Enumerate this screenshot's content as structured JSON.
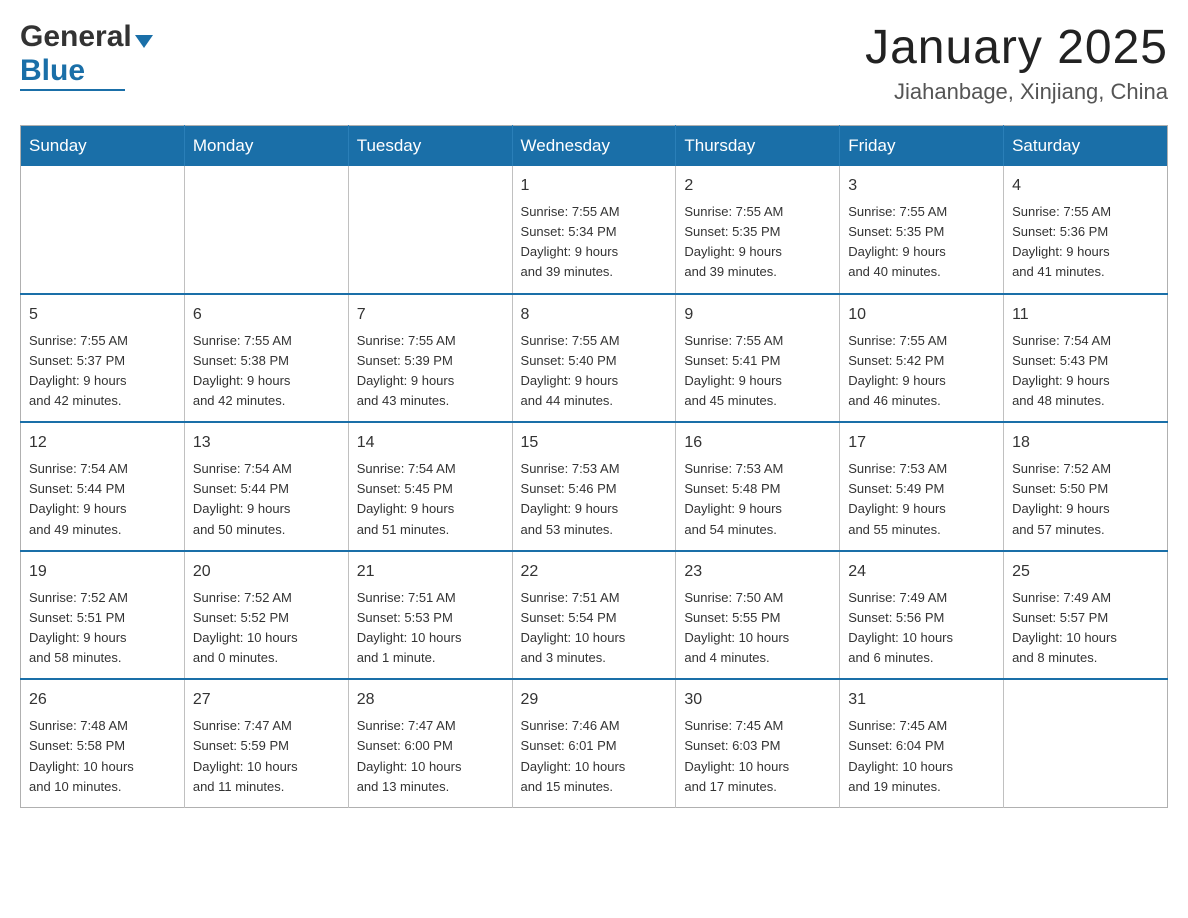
{
  "header": {
    "title": "January 2025",
    "subtitle": "Jiahanbage, Xinjiang, China"
  },
  "logo": {
    "general": "General",
    "blue": "Blue"
  },
  "days": [
    "Sunday",
    "Monday",
    "Tuesday",
    "Wednesday",
    "Thursday",
    "Friday",
    "Saturday"
  ],
  "weeks": [
    [
      {
        "day": "",
        "info": ""
      },
      {
        "day": "",
        "info": ""
      },
      {
        "day": "",
        "info": ""
      },
      {
        "day": "1",
        "info": "Sunrise: 7:55 AM\nSunset: 5:34 PM\nDaylight: 9 hours\nand 39 minutes."
      },
      {
        "day": "2",
        "info": "Sunrise: 7:55 AM\nSunset: 5:35 PM\nDaylight: 9 hours\nand 39 minutes."
      },
      {
        "day": "3",
        "info": "Sunrise: 7:55 AM\nSunset: 5:35 PM\nDaylight: 9 hours\nand 40 minutes."
      },
      {
        "day": "4",
        "info": "Sunrise: 7:55 AM\nSunset: 5:36 PM\nDaylight: 9 hours\nand 41 minutes."
      }
    ],
    [
      {
        "day": "5",
        "info": "Sunrise: 7:55 AM\nSunset: 5:37 PM\nDaylight: 9 hours\nand 42 minutes."
      },
      {
        "day": "6",
        "info": "Sunrise: 7:55 AM\nSunset: 5:38 PM\nDaylight: 9 hours\nand 42 minutes."
      },
      {
        "day": "7",
        "info": "Sunrise: 7:55 AM\nSunset: 5:39 PM\nDaylight: 9 hours\nand 43 minutes."
      },
      {
        "day": "8",
        "info": "Sunrise: 7:55 AM\nSunset: 5:40 PM\nDaylight: 9 hours\nand 44 minutes."
      },
      {
        "day": "9",
        "info": "Sunrise: 7:55 AM\nSunset: 5:41 PM\nDaylight: 9 hours\nand 45 minutes."
      },
      {
        "day": "10",
        "info": "Sunrise: 7:55 AM\nSunset: 5:42 PM\nDaylight: 9 hours\nand 46 minutes."
      },
      {
        "day": "11",
        "info": "Sunrise: 7:54 AM\nSunset: 5:43 PM\nDaylight: 9 hours\nand 48 minutes."
      }
    ],
    [
      {
        "day": "12",
        "info": "Sunrise: 7:54 AM\nSunset: 5:44 PM\nDaylight: 9 hours\nand 49 minutes."
      },
      {
        "day": "13",
        "info": "Sunrise: 7:54 AM\nSunset: 5:44 PM\nDaylight: 9 hours\nand 50 minutes."
      },
      {
        "day": "14",
        "info": "Sunrise: 7:54 AM\nSunset: 5:45 PM\nDaylight: 9 hours\nand 51 minutes."
      },
      {
        "day": "15",
        "info": "Sunrise: 7:53 AM\nSunset: 5:46 PM\nDaylight: 9 hours\nand 53 minutes."
      },
      {
        "day": "16",
        "info": "Sunrise: 7:53 AM\nSunset: 5:48 PM\nDaylight: 9 hours\nand 54 minutes."
      },
      {
        "day": "17",
        "info": "Sunrise: 7:53 AM\nSunset: 5:49 PM\nDaylight: 9 hours\nand 55 minutes."
      },
      {
        "day": "18",
        "info": "Sunrise: 7:52 AM\nSunset: 5:50 PM\nDaylight: 9 hours\nand 57 minutes."
      }
    ],
    [
      {
        "day": "19",
        "info": "Sunrise: 7:52 AM\nSunset: 5:51 PM\nDaylight: 9 hours\nand 58 minutes."
      },
      {
        "day": "20",
        "info": "Sunrise: 7:52 AM\nSunset: 5:52 PM\nDaylight: 10 hours\nand 0 minutes."
      },
      {
        "day": "21",
        "info": "Sunrise: 7:51 AM\nSunset: 5:53 PM\nDaylight: 10 hours\nand 1 minute."
      },
      {
        "day": "22",
        "info": "Sunrise: 7:51 AM\nSunset: 5:54 PM\nDaylight: 10 hours\nand 3 minutes."
      },
      {
        "day": "23",
        "info": "Sunrise: 7:50 AM\nSunset: 5:55 PM\nDaylight: 10 hours\nand 4 minutes."
      },
      {
        "day": "24",
        "info": "Sunrise: 7:49 AM\nSunset: 5:56 PM\nDaylight: 10 hours\nand 6 minutes."
      },
      {
        "day": "25",
        "info": "Sunrise: 7:49 AM\nSunset: 5:57 PM\nDaylight: 10 hours\nand 8 minutes."
      }
    ],
    [
      {
        "day": "26",
        "info": "Sunrise: 7:48 AM\nSunset: 5:58 PM\nDaylight: 10 hours\nand 10 minutes."
      },
      {
        "day": "27",
        "info": "Sunrise: 7:47 AM\nSunset: 5:59 PM\nDaylight: 10 hours\nand 11 minutes."
      },
      {
        "day": "28",
        "info": "Sunrise: 7:47 AM\nSunset: 6:00 PM\nDaylight: 10 hours\nand 13 minutes."
      },
      {
        "day": "29",
        "info": "Sunrise: 7:46 AM\nSunset: 6:01 PM\nDaylight: 10 hours\nand 15 minutes."
      },
      {
        "day": "30",
        "info": "Sunrise: 7:45 AM\nSunset: 6:03 PM\nDaylight: 10 hours\nand 17 minutes."
      },
      {
        "day": "31",
        "info": "Sunrise: 7:45 AM\nSunset: 6:04 PM\nDaylight: 10 hours\nand 19 minutes."
      },
      {
        "day": "",
        "info": ""
      }
    ]
  ]
}
